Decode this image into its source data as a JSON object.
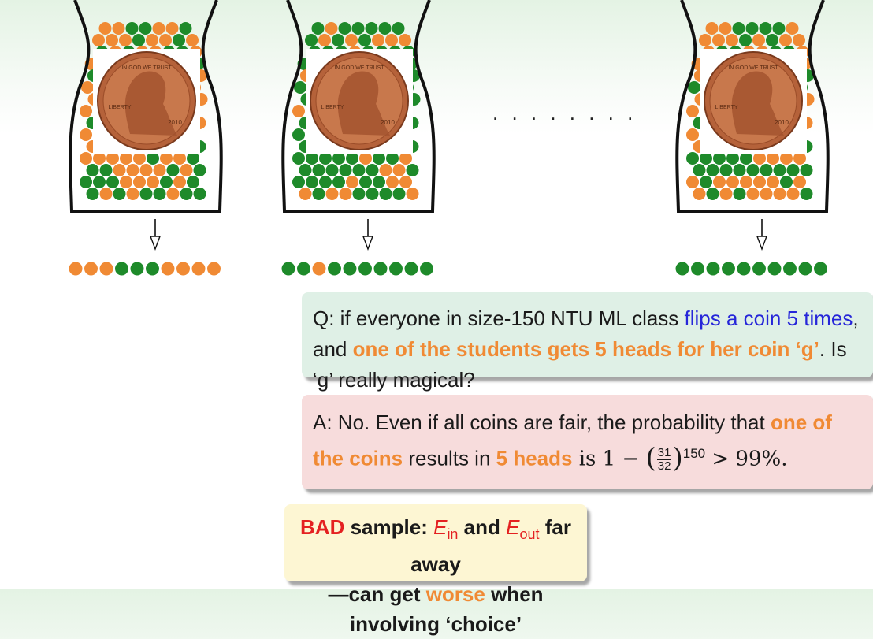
{
  "coin": {
    "motto": "IN GOD WE TRUST",
    "liberty": "LIBERTY",
    "year": "2010"
  },
  "ellipsis": ". . . . . . . .",
  "colors": {
    "orange": "#f08a34",
    "green": "#1e8a2a",
    "blue": "#2626d9",
    "red": "#e42121"
  },
  "question": {
    "prefix": "Q: if everyone in size-150 NTU ML class ",
    "highlight1": "flips a coin 5 times",
    "middle": ", and ",
    "highlight2": "one of the students gets 5 heads for her coin ‘g’",
    "suffix": ". Is ‘g’ really magical?"
  },
  "answer": {
    "prefix": "A: No. Even if all coins are fair, the probability that ",
    "highlight1": "one of the coins",
    "middle": " results in ",
    "highlight2": "5 heads",
    "formula_lead": " is 1 − ",
    "frac_num": "31",
    "frac_den": "32",
    "exponent": "150",
    "formula_tail": " > 99%."
  },
  "summary": {
    "bad": "BAD",
    "line1_a": " sample: ",
    "e_in_E": "E",
    "e_in_sub": "in",
    "and": " and ",
    "e_out_E": "E",
    "e_out_sub": "out",
    "far": " far away",
    "line2_a": "—can get ",
    "worse": "worse",
    "line2_b": " when involving ‘choice’"
  }
}
